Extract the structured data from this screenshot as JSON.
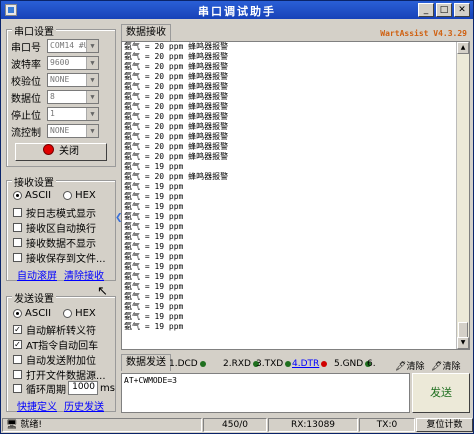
{
  "window": {
    "title": "串口调试助手"
  },
  "serial_settings": {
    "title": "串口设置",
    "fields": [
      {
        "label": "串口号",
        "value": "COM14 #US"
      },
      {
        "label": "波特率",
        "value": "9600"
      },
      {
        "label": "校验位",
        "value": "NONE"
      },
      {
        "label": "数据位",
        "value": "8"
      },
      {
        "label": "停止位",
        "value": "1"
      },
      {
        "label": "流控制",
        "value": "NONE"
      }
    ],
    "close_button": "关闭",
    "status_color": "#e00000"
  },
  "receive_settings": {
    "title": "接收设置",
    "mode_ascii": "ASCII",
    "mode_hex": "HEX",
    "options": [
      {
        "label": "按日志模式显示",
        "checked": false
      },
      {
        "label": "接收区自动换行",
        "checked": false
      },
      {
        "label": "接收数据不显示",
        "checked": false
      },
      {
        "label": "接收保存到文件...",
        "checked": false
      }
    ],
    "auto_scroll": "自动滚屏",
    "clear_receive": "清除接收"
  },
  "send_settings": {
    "title": "发送设置",
    "mode_ascii": "ASCII",
    "mode_hex": "HEX",
    "options": [
      {
        "label": "自动解析转义符",
        "checked": true
      },
      {
        "label": "AT指令自动回车",
        "checked": true
      },
      {
        "label": "自动发送附加位",
        "checked": false
      },
      {
        "label": "打开文件数据源...",
        "checked": false
      }
    ],
    "cycle_label": "循环周期",
    "cycle_value": "1000",
    "cycle_unit": "ms",
    "shortcut": "快捷定义",
    "history": "历史发送"
  },
  "receive_area": {
    "tab": "数据接收",
    "brand": "WartAssist V4.3.29",
    "lines": [
      "氨气 = 20 ppm 蜂鸣器报警",
      "氨气 = 20 ppm 蜂鸣器报警",
      "氨气 = 20 ppm 蜂鸣器报警",
      "氨气 = 20 ppm 蜂鸣器报警",
      "氨气 = 20 ppm 蜂鸣器报警",
      "氨气 = 20 ppm 蜂鸣器报警",
      "氨气 = 20 ppm 蜂鸣器报警",
      "氨气 = 20 ppm 蜂鸣器报警",
      "氨气 = 20 ppm 蜂鸣器报警",
      "氨气 = 20 ppm 蜂鸣器报警",
      "氨气 = 20 ppm 蜂鸣器报警",
      "氨气 = 20 ppm 蜂鸣器报警",
      "氨气 = 19 ppm",
      "氨气 = 20 ppm 蜂鸣器报警",
      "氨气 = 19 ppm",
      "氨气 = 19 ppm",
      "氨气 = 19 ppm",
      "氨气 = 19 ppm",
      "氨气 = 19 ppm",
      "氨气 = 19 ppm",
      "氨气 = 19 ppm",
      "氨气 = 19 ppm",
      "氨气 = 19 ppm",
      "氨气 = 19 ppm",
      "氨气 = 19 ppm",
      "氨气 = 19 ppm",
      "氨气 = 19 ppm",
      "氨气 = 19 ppm",
      "氨气 = 19 ppm"
    ]
  },
  "send_area": {
    "tab": "数据发送",
    "signals": [
      {
        "label": "1.DCD",
        "color": "#1f6f1f"
      },
      {
        "label": "2.RXD",
        "color": "#1f6f1f"
      },
      {
        "label": "3.TXD",
        "color": "#1f6f1f"
      },
      {
        "label": "4.DTR",
        "color": "#d00000"
      },
      {
        "label": "5.GND",
        "color": "#1f6f1f"
      },
      {
        "label": "6.",
        "color": "#1f6f1f"
      }
    ],
    "clear1": "清除",
    "clear2": "清除",
    "input_value": "AT+CWMODE=3",
    "send_button": "发送"
  },
  "status_bar": {
    "ready": "就绪!",
    "count": "450/0",
    "rx": "RX:13089",
    "tx": "TX:0",
    "reset": "复位计数"
  }
}
